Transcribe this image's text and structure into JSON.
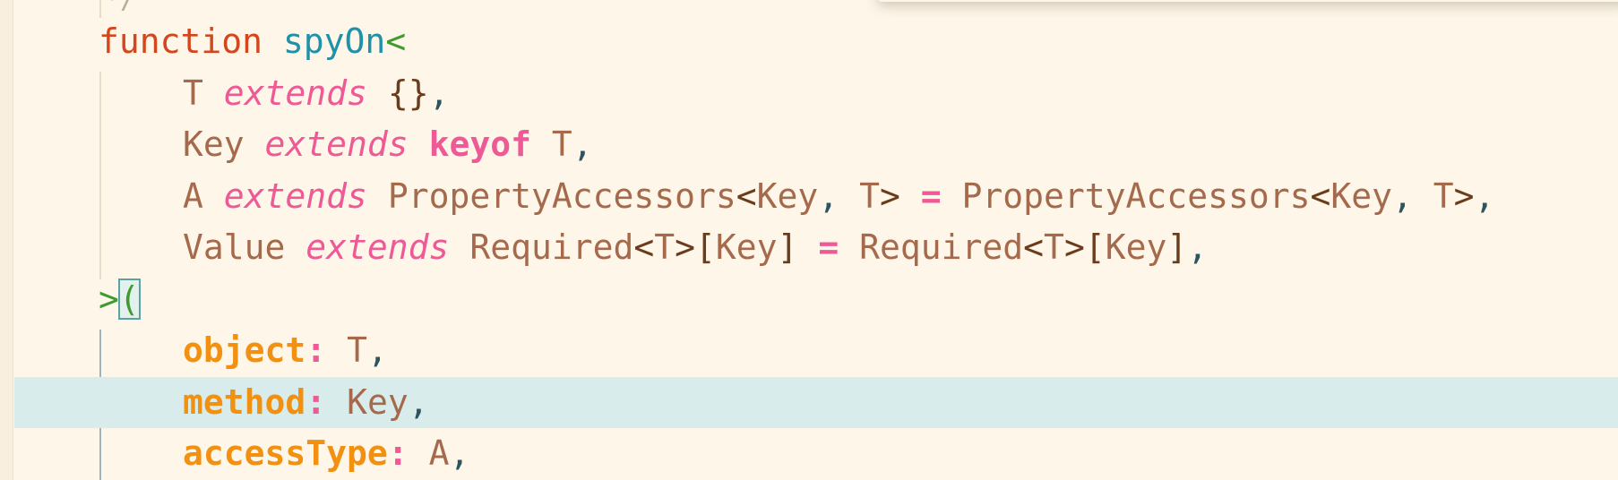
{
  "editor": {
    "language": "typescript",
    "colors": {
      "background": "#fdf6e9",
      "current_line": "#d9ecec",
      "keyword": "#d4471e",
      "function_name": "#1f91a8",
      "bracket": "#3f9a2f",
      "type": "#a56a4c",
      "extends": "#ee5a95",
      "property": "#f29111"
    },
    "leading_glyph": "*/",
    "line1": {
      "keyword": "function",
      "space": " ",
      "name": "spyOn",
      "open": "<"
    },
    "line2": {
      "type": "T",
      "ext": "extends",
      "brace": "{}",
      "comma": ","
    },
    "line3": {
      "type": "Key",
      "ext": "extends",
      "keyof": "keyof",
      "ref": "T",
      "comma": ","
    },
    "line4": {
      "type": "A",
      "ext": "extends",
      "generic": "PropertyAccessors",
      "lt": "<",
      "arg1": "Key",
      "sep": ",",
      "arg2": "T",
      "gt": ">",
      "eq": "=",
      "generic2": "PropertyAccessors",
      "lt2": "<",
      "arg3": "Key",
      "sep2": ",",
      "arg4": "T",
      "gt2": ">",
      "comma": ","
    },
    "line5": {
      "type": "Value",
      "ext": "extends",
      "generic": "Required",
      "lt": "<",
      "arg": "T",
      "gt": ">",
      "lb": "[",
      "key": "Key",
      "rb": "]",
      "eq": "=",
      "generic2": "Required",
      "lt2": "<",
      "arg2": "T",
      "gt2": ">",
      "lb2": "[",
      "key2": "Key",
      "rb2": "]",
      "comma": ","
    },
    "line6": {
      "close": ">",
      "paren": "("
    },
    "line7": {
      "prop": "object",
      "colon": ":",
      "type": "T",
      "comma": ","
    },
    "line8": {
      "prop": "method",
      "colon": ":",
      "type": "Key",
      "comma": ","
    },
    "line9": {
      "prop": "accessType",
      "colon": ":",
      "type": "A",
      "comma": ","
    }
  }
}
